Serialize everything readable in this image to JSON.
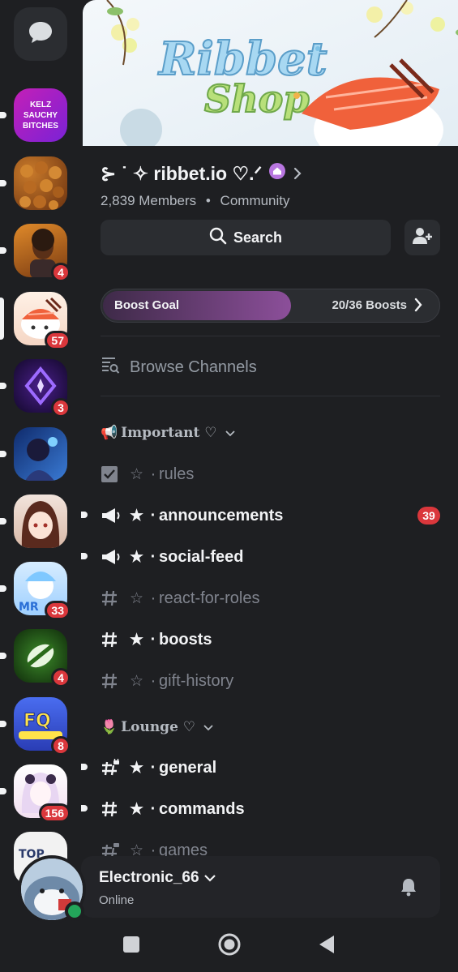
{
  "servers": [
    {
      "name": "dm",
      "badge": ""
    },
    {
      "name": "kelz-sauchy",
      "text": "KELZ SAUCHY BITCHES",
      "badge": ""
    },
    {
      "name": "food",
      "badge": ""
    },
    {
      "name": "kelz-server",
      "badge": "4"
    },
    {
      "name": "ribbet",
      "badge": "57"
    },
    {
      "name": "purple-star",
      "badge": "3"
    },
    {
      "name": "anime-blue",
      "badge": ""
    },
    {
      "name": "anime-girl",
      "badge": ""
    },
    {
      "name": "mr",
      "badge": "33"
    },
    {
      "name": "green",
      "badge": "4"
    },
    {
      "name": "fq-marchers",
      "badge": "8"
    },
    {
      "name": "pink-anime",
      "badge": "156"
    },
    {
      "name": "top",
      "badge": ""
    }
  ],
  "banner": {
    "line1": "Ribbet",
    "line2": "Shop"
  },
  "server": {
    "name": "⊱ ˙ ✧ ribbet.io ♡.ᐟ",
    "members": "2,839 Members",
    "sep": "•",
    "type": "Community"
  },
  "search": {
    "label": "Search"
  },
  "boost": {
    "label": "Boost Goal",
    "count": "20/36 Boosts",
    "progress": 0.5556
  },
  "browse": {
    "label": "Browse Channels"
  },
  "categories": [
    {
      "emoji": "📢",
      "name": "Important ♡"
    },
    {
      "emoji": "🌷",
      "name": "Lounge ♡"
    }
  ],
  "channels": [
    {
      "name": "rules",
      "star": "☆",
      "dot": "·"
    },
    {
      "name": "announcements",
      "star": "★",
      "dot": "·",
      "badge": "39"
    },
    {
      "name": "social-feed",
      "star": "★",
      "dot": "·"
    },
    {
      "name": "react-for-roles",
      "star": "☆",
      "dot": "·"
    },
    {
      "name": "boosts",
      "star": "★",
      "dot": "·"
    },
    {
      "name": "gift-history",
      "star": "☆",
      "dot": "·"
    },
    {
      "name": "general",
      "star": "★",
      "dot": "·"
    },
    {
      "name": "commands",
      "star": "★",
      "dot": "·"
    },
    {
      "name": "games",
      "star": "☆",
      "dot": "·"
    }
  ],
  "user": {
    "name": "Electronic_66",
    "status": "Online"
  },
  "colors": {
    "accent": "#8c4f9a",
    "badge": "#da373c",
    "online": "#23a55a"
  }
}
